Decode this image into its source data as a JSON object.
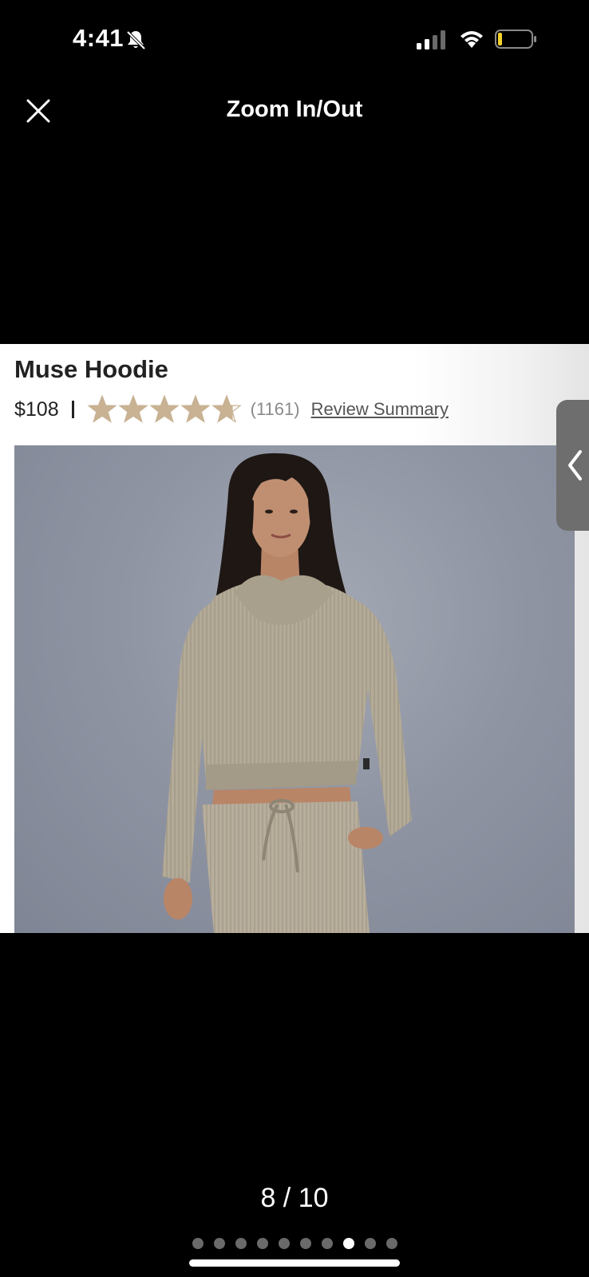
{
  "status_bar": {
    "time": "4:41",
    "icons": [
      "bell-slash-icon",
      "cellular-signal-icon",
      "wifi-icon",
      "battery-low-icon"
    ]
  },
  "header": {
    "title": "Zoom In/Out",
    "close_icon": "close-icon"
  },
  "product": {
    "name": "Muse Hoodie",
    "price": "$108",
    "rating": 4.7,
    "rating_max": 5,
    "review_count": "(1161)",
    "review_summary_label": "Review Summary",
    "star_color": "#c8b293"
  },
  "pager": {
    "label": "8 / 10",
    "current": 8,
    "total": 10
  },
  "side_tab": {
    "icon": "chevron-left-icon"
  }
}
